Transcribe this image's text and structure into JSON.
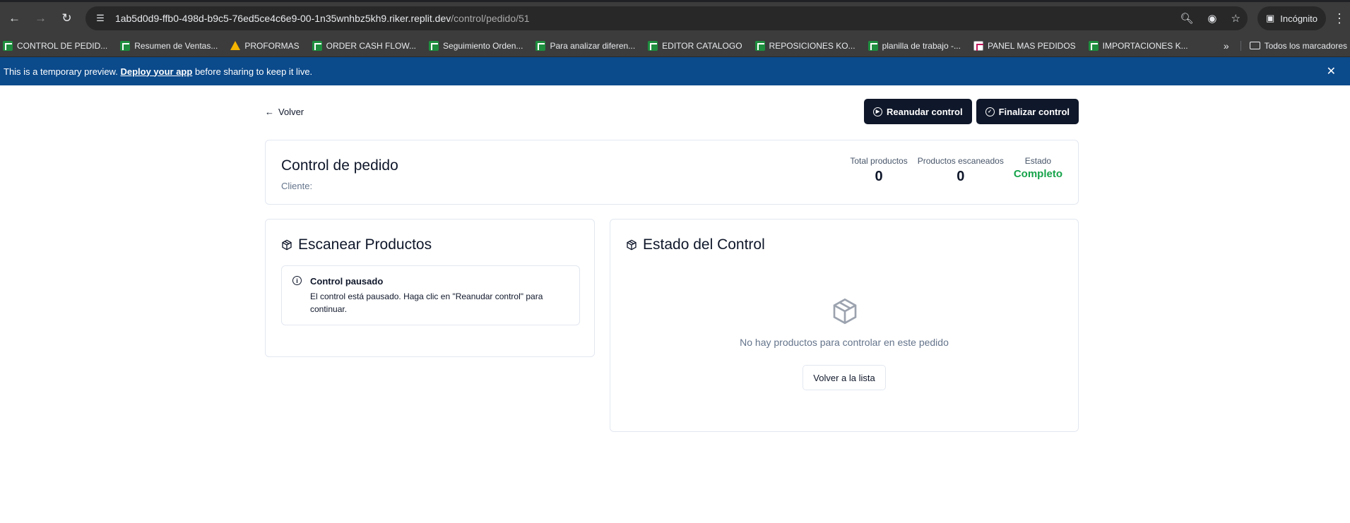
{
  "browser": {
    "url_host": "1ab5d0d9-ffb0-498d-b9c5-76ed5ce4c6e9-00-1n35wnhbz5kh9.riker.replit.dev",
    "url_path": "/control/pedido/51",
    "incognito_label": "Incógnito",
    "bookmarks": [
      {
        "label": "CONTROL DE PEDID...",
        "icon": "sheets"
      },
      {
        "label": "Resumen de Ventas...",
        "icon": "sheets"
      },
      {
        "label": "PROFORMAS",
        "icon": "drive"
      },
      {
        "label": "ORDER CASH FLOW...",
        "icon": "sheets"
      },
      {
        "label": "Seguimiento Orden...",
        "icon": "sheets"
      },
      {
        "label": "Para analizar diferen...",
        "icon": "sheets"
      },
      {
        "label": "EDITOR CATALOGO",
        "icon": "sheets"
      },
      {
        "label": "REPOSICIONES KO...",
        "icon": "sheets"
      },
      {
        "label": "planilla de trabajo -...",
        "icon": "sheets"
      },
      {
        "label": "PANEL MAS PEDIDOS",
        "icon": "panel"
      },
      {
        "label": "IMPORTACIONES K...",
        "icon": "sheets"
      }
    ],
    "all_bookmarks_label": "Todos los marcadores"
  },
  "banner": {
    "prefix": "This is a temporary preview.",
    "link": "Deploy your app",
    "suffix": "before sharing to keep it live."
  },
  "topbar": {
    "back_label": "Volver",
    "resume_label": "Reanudar control",
    "finish_label": "Finalizar control"
  },
  "summary": {
    "title": "Control de pedido",
    "client_label": "Cliente:",
    "stats": [
      {
        "label": "Total productos",
        "value": "0"
      },
      {
        "label": "Productos escaneados",
        "value": "0"
      },
      {
        "label": "Estado",
        "value": "Completo"
      }
    ],
    "status_color": "#16a34a"
  },
  "scan": {
    "title": "Escanear Productos",
    "alert_title": "Control pausado",
    "alert_text": "El control está pausado. Haga clic en \"Reanudar control\" para continuar."
  },
  "status_card": {
    "title": "Estado del Control",
    "empty_message": "No hay productos para controlar en este pedido",
    "back_to_list": "Volver a la lista"
  }
}
